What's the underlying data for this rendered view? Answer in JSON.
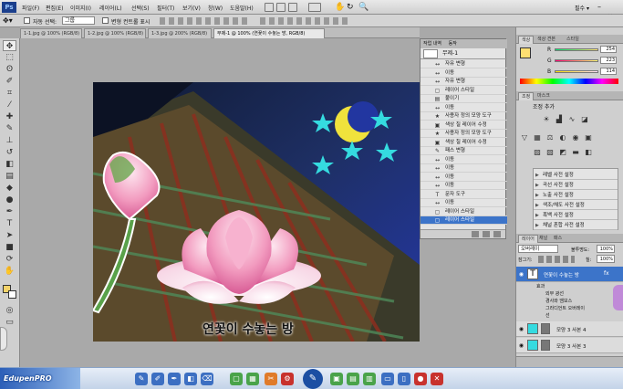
{
  "menu": {
    "logo": "Ps",
    "items": [
      "파일(F)",
      "편집(E)",
      "이미지(I)",
      "레이어(L)",
      "선택(S)",
      "필터(T)",
      "보기(V)",
      "창(W)",
      "도움말(H)"
    ],
    "workspace": "필수 ▾"
  },
  "options": {
    "auto_select": "자동 선택:",
    "auto_select_value": "그룹",
    "transform_controls": "변형 컨트롤 표시"
  },
  "tabs": [
    "1-1.jpg @ 100% (RGB/8)",
    "1-2.jpg @ 100% (RGB/8)",
    "1-3.jpg @ 200% (RGB/8)",
    "무제-1 @ 100% (연꽃이 수놓는 방, RGB/8)"
  ],
  "canvas": {
    "text": "연꽃이 수놓는 방"
  },
  "history": {
    "tabs": [
      "작업 내역",
      "동작"
    ],
    "snapshot": "무제-1",
    "items": [
      {
        "icon": "move-icon",
        "glyph": "↔",
        "label": "자유 변형"
      },
      {
        "icon": "move-icon",
        "glyph": "↔",
        "label": "이동"
      },
      {
        "icon": "move-icon",
        "glyph": "↔",
        "label": "자유 변형"
      },
      {
        "icon": "layer-style-icon",
        "glyph": "▢",
        "label": "레이어 스타일"
      },
      {
        "icon": "paste-icon",
        "glyph": "▤",
        "label": "붙이기"
      },
      {
        "icon": "move-icon",
        "glyph": "↔",
        "label": "이동"
      },
      {
        "icon": "shape-icon",
        "glyph": "★",
        "label": "사용자 정의 모양 도구"
      },
      {
        "icon": "fill-icon",
        "glyph": "▣",
        "label": "색상 칠 레이어 수정"
      },
      {
        "icon": "shape-icon",
        "glyph": "★",
        "label": "사용자 정의 모양 도구"
      },
      {
        "icon": "fill-icon",
        "glyph": "▣",
        "label": "색상 칠 레이어 수정"
      },
      {
        "icon": "path-icon",
        "glyph": "✎",
        "label": "패스 변형"
      },
      {
        "icon": "move-icon",
        "glyph": "↔",
        "label": "이동"
      },
      {
        "icon": "move-icon",
        "glyph": "↔",
        "label": "이동"
      },
      {
        "icon": "move-icon",
        "glyph": "↔",
        "label": "이동"
      },
      {
        "icon": "move-icon",
        "glyph": "↔",
        "label": "이동"
      },
      {
        "icon": "text-icon",
        "glyph": "T",
        "label": "문자 도구"
      },
      {
        "icon": "move-icon",
        "glyph": "↔",
        "label": "이동"
      },
      {
        "icon": "layer-style-icon",
        "glyph": "▢",
        "label": "레이어 스타일"
      },
      {
        "icon": "layer-style-icon",
        "glyph": "▢",
        "label": "레이어 스타일"
      }
    ]
  },
  "color_panel": {
    "tabs": [
      "색상",
      "색상 견본",
      "스타일"
    ],
    "r": {
      "label": "R",
      "value": "254"
    },
    "g": {
      "label": "G",
      "value": "223"
    },
    "b": {
      "label": "B",
      "value": "114"
    },
    "fg": "#fedf72"
  },
  "adjustments": {
    "tabs": [
      "조정",
      "마스크"
    ],
    "title": "조정 추가",
    "presets": [
      "레벨 사전 설정",
      "곡선 사전 설정",
      "노출 사전 설정",
      "색조/채도 사전 설정",
      "흑백 사전 설정",
      "채널 혼합 사전 설정"
    ]
  },
  "layers": {
    "tabs": [
      "레이어",
      "채널",
      "패스"
    ],
    "blend_mode": "오버레이",
    "opacity_label": "불투명도:",
    "opacity": "100%",
    "lock_label": "잠그기:",
    "fill_label": "칠:",
    "fill": "100%",
    "text_layer": "연꽃이 수놓는 방",
    "effects_label": "효과",
    "effects": [
      "외부 광선",
      "경사와 엠보스",
      "그라디언트 오버레이",
      "선"
    ],
    "shape_layers": [
      "모양 3 사본 4",
      "모양 3 사본 3"
    ]
  },
  "taskbar": {
    "brand": "EdupenPRO"
  }
}
